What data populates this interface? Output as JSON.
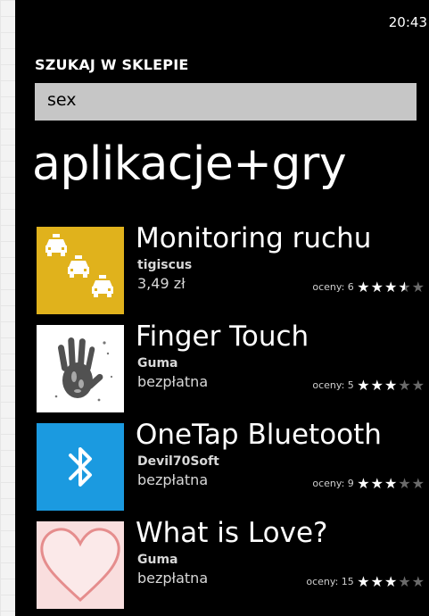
{
  "status": {
    "time": "20:43"
  },
  "search": {
    "label": "SZUKAJ W SKLEPIE",
    "query": "sex"
  },
  "section": {
    "title": "aplikacje+gry"
  },
  "apps": [
    {
      "name": "Monitoring ruchu",
      "publisher": "tigiscus",
      "price": "3,49 zł",
      "ratings_label": "oceny: 6",
      "stars": 3.5,
      "tile_color": "#e0b21c",
      "icon": "taxi-icon"
    },
    {
      "name": "Finger Touch",
      "publisher": "Guma",
      "price": "bezpłatna",
      "ratings_label": "oceny: 5",
      "stars": 3,
      "tile_color": "#ffffff",
      "icon": "handprint-icon"
    },
    {
      "name": "OneTap Bluetooth",
      "publisher": "Devil70Soft",
      "price": "bezpłatna",
      "ratings_label": "oceny: 9",
      "stars": 3,
      "tile_color": "#1b9ae0",
      "icon": "bluetooth-icon"
    },
    {
      "name": "What is Love?",
      "publisher": "Guma",
      "price": "bezpłatna",
      "ratings_label": "oceny: 15",
      "stars": 3,
      "tile_color": "#f9dede",
      "icon": "heart-icon"
    }
  ]
}
